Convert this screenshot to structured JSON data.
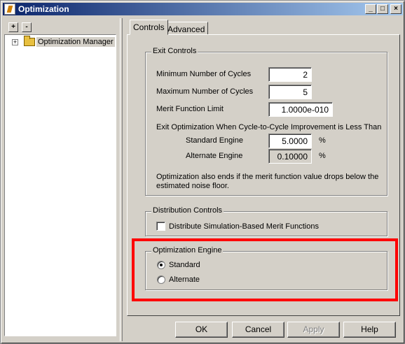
{
  "window": {
    "title": "Optimization",
    "controls": {
      "minimize": "_",
      "maximize": "□",
      "close": "×"
    }
  },
  "tree": {
    "expand_all": "+",
    "collapse_all": "-",
    "node_expander": "+",
    "node_label": "Optimization Manager"
  },
  "tabs": {
    "controls": "Controls",
    "advanced": "Advanced"
  },
  "exit_controls": {
    "title": "Exit Controls",
    "min_cycles_label": "Minimum Number of Cycles",
    "min_cycles_value": "2",
    "max_cycles_label": "Maximum Number of Cycles",
    "max_cycles_value": "5",
    "merit_limit_label": "Merit Function Limit",
    "merit_limit_value": "1.0000e-010",
    "improvement_label": "Exit Optimization When Cycle-to-Cycle Improvement is Less Than",
    "standard_label": "Standard Engine",
    "standard_value": "5.0000",
    "alternate_label": "Alternate Engine",
    "alternate_value": "0.10000",
    "percent": "%",
    "note_line1": "Optimization also ends if the merit function value drops below the",
    "note_line2": "estimated noise floor."
  },
  "distribution_controls": {
    "title": "Distribution Controls",
    "checkbox_label": "Distribute Simulation-Based Merit Functions",
    "checked": false
  },
  "optimization_engine": {
    "title": "Optimization Engine",
    "standard": "Standard",
    "alternate": "Alternate",
    "selected": "Standard"
  },
  "buttons": {
    "ok": "OK",
    "cancel": "Cancel",
    "apply": "Apply",
    "help": "Help"
  },
  "colors": {
    "titlebar_start": "#0a246a",
    "titlebar_end": "#a6caf0",
    "highlight": "#ff0000",
    "face": "#d4d0c8"
  }
}
